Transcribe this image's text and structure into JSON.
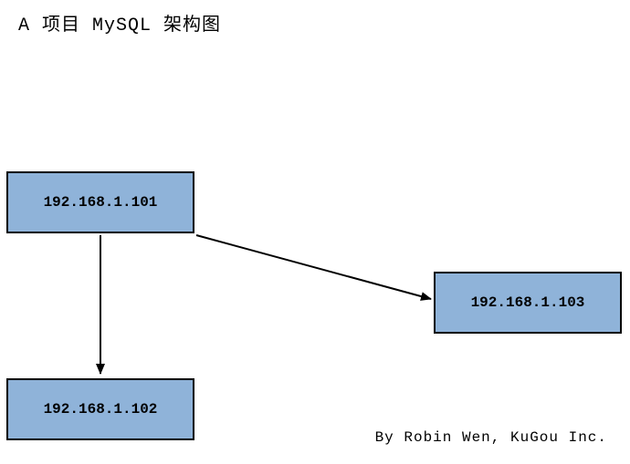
{
  "title": "A 项目 MySQL 架构图",
  "nodes": {
    "n1": {
      "label": "192.168.1.101"
    },
    "n2": {
      "label": "192.168.1.102"
    },
    "n3": {
      "label": "192.168.1.103"
    }
  },
  "credit": "By Robin Wen, KuGou Inc.",
  "chart_data": {
    "type": "diagram",
    "title": "A 项目 MySQL 架构图",
    "nodes": [
      {
        "id": "n1",
        "label": "192.168.1.101"
      },
      {
        "id": "n2",
        "label": "192.168.1.102"
      },
      {
        "id": "n3",
        "label": "192.168.1.103"
      }
    ],
    "edges": [
      {
        "from": "n1",
        "to": "n2"
      },
      {
        "from": "n1",
        "to": "n3"
      }
    ],
    "annotation": "By Robin Wen, KuGou Inc."
  }
}
